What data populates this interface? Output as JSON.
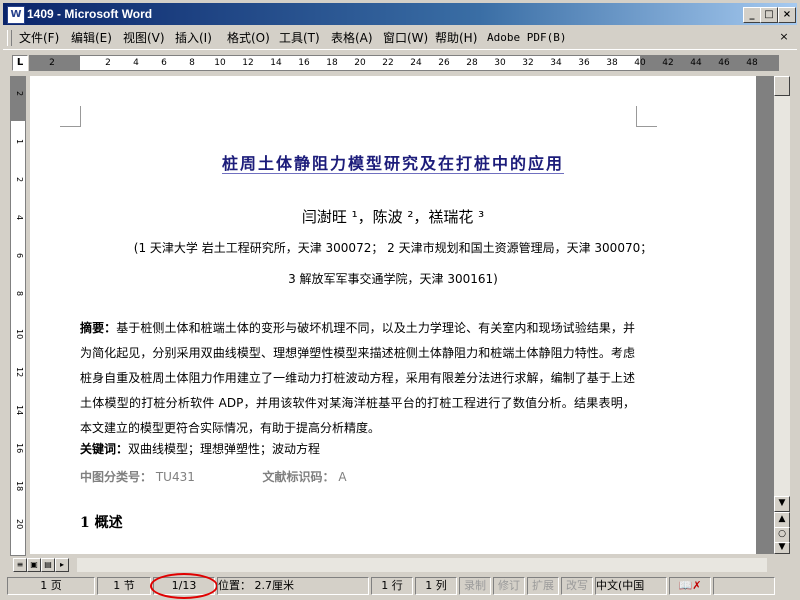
{
  "window": {
    "title": "1409 - Microsoft Word",
    "app_icon": "W",
    "controls": [
      "_",
      "□",
      "×"
    ]
  },
  "menu": {
    "items": [
      "文件(F)",
      "编辑(E)",
      "视图(V)",
      "插入(I)",
      "格式(O)",
      "工具(T)",
      "表格(A)",
      "窗口(W)",
      "帮助(H)",
      "Adobe PDF(B)"
    ],
    "doc_close": "×"
  },
  "ruler": {
    "tab_selector": "L",
    "ticks": [
      "2",
      "2",
      "4",
      "6",
      "8",
      "10",
      "12",
      "14",
      "16",
      "18",
      "20",
      "22",
      "24",
      "26",
      "28",
      "30",
      "32",
      "34",
      "36",
      "38",
      "40",
      "42",
      "44",
      "46",
      "48"
    ]
  },
  "vruler": {
    "ticks": [
      "2",
      "1",
      "2",
      "4",
      "6",
      "8",
      "10",
      "12",
      "14",
      "16",
      "18",
      "20"
    ]
  },
  "document": {
    "title": "桩周土体静阻力模型研究及在打桩中的应用",
    "authors": "闫澍旺 ¹，陈波 ²，禚瑞花 ³",
    "affiliation_line1": "(1 天津大学 岩土工程研究所，天津 300072；  2 天津市规划和国土资源管理局，天津 300070；",
    "affiliation_line2": "3  解放军军事交通学院，天津 300161)",
    "abstract_label": "摘要：",
    "abstract_text": "基于桩侧土体和桩端土体的变形与破坏机理不同，以及土力学理论、有关室内和现场试验结果，并为简化起见，分别采用双曲线模型、理想弹塑性模型来描述桩侧土体静阻力和桩端土体静阻力特性。考虑桩身自重及桩周土体阻力作用建立了一维动力打桩波动方程，采用有限差分法进行求解，编制了基于上述土体模型的打桩分析软件 ADP，并用该软件对某海洋桩基平台的打桩工程进行了数值分析。结果表明，本文建立的模型更符合实际情况，有助于提高分析精度。",
    "keywords_label": "关键词：",
    "keywords_text": "双曲线模型；理想弹塑性；波动方程",
    "class_label": "中图分类号：",
    "class_value": "TU431",
    "doccode_label": "文献标识码：",
    "doccode_value": "A",
    "section_heading": "1   概述"
  },
  "statusbar": {
    "page": "1 页",
    "section": "1 节",
    "page_of": "1/13",
    "position": "位置： 2.7厘米",
    "line": "1 行",
    "column": "1 列",
    "rec": "录制",
    "trk": "修订",
    "ext": "扩展",
    "ovr": "改写",
    "language": "中文(中国",
    "spell_icon": "spell-check-error-icon"
  },
  "highlight_color": "#e00000"
}
